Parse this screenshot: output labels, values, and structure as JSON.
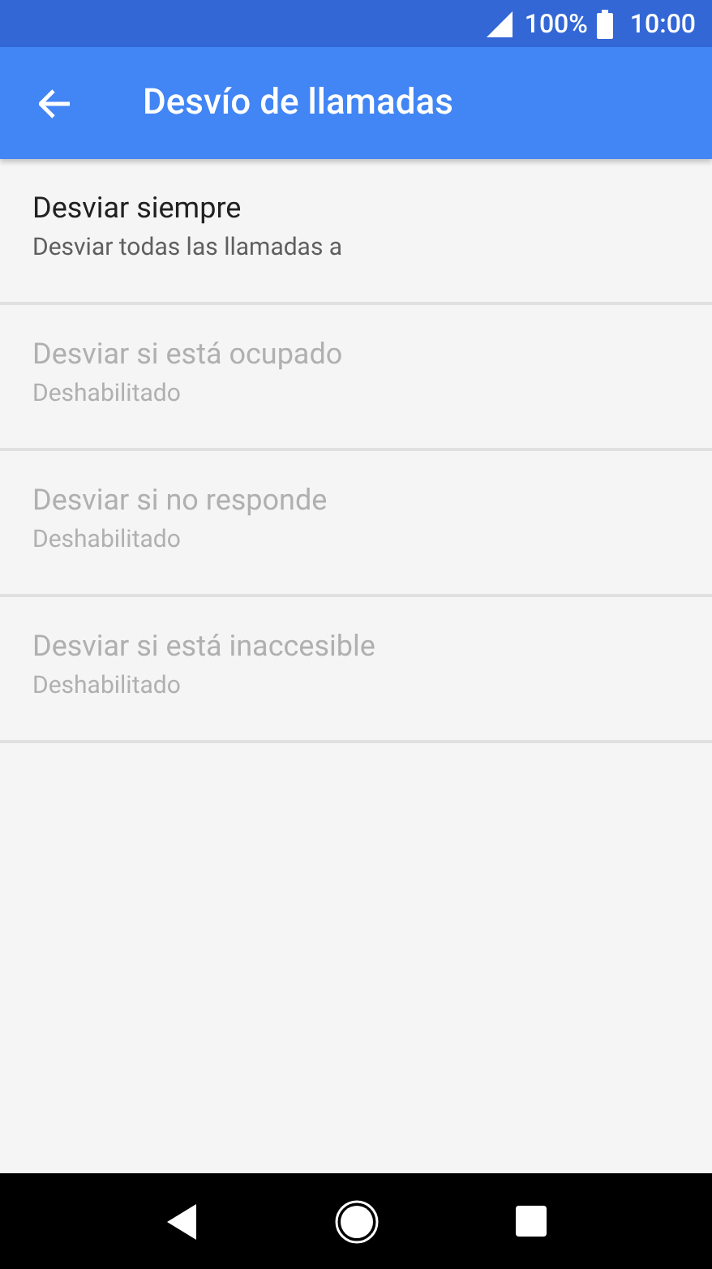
{
  "status_bar": {
    "battery": "100%",
    "time": "10:00"
  },
  "app_bar": {
    "title": "Desvío de llamadas"
  },
  "items": [
    {
      "title": "Desviar siempre",
      "summary": "Desviar todas las llamadas a",
      "disabled": false
    },
    {
      "title": "Desviar si está ocupado",
      "summary": "Deshabilitado",
      "disabled": true
    },
    {
      "title": "Desviar si no responde",
      "summary": "Deshabilitado",
      "disabled": true
    },
    {
      "title": "Desviar si está inaccesible",
      "summary": "Deshabilitado",
      "disabled": true
    }
  ]
}
